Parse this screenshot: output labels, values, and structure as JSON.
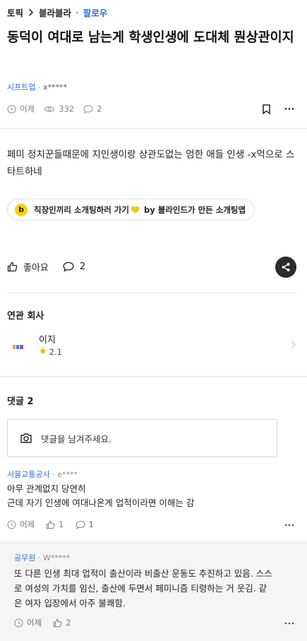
{
  "breadcrumb": {
    "topic": "토픽",
    "board": "블라블라",
    "follow": "팔로우"
  },
  "post": {
    "title": "동덕이 여대로 남는게 학생인생에 도대체 뭔상관이지",
    "company": "시프트업",
    "author": "x*****",
    "time": "어제",
    "views": "332",
    "comment_count": "2",
    "body": "페미 정치꾼들때문에 지인생이랑 상관도없는 엄한 애들 인생 -x억으로 스타트하네"
  },
  "ad": {
    "logo_letter": "b",
    "text_before": "직장인끼리 소개팅하러 가기",
    "text_after": "by 블라인드가 만든 소개팅앱"
  },
  "actions": {
    "like_label": "좋아요",
    "comment_count": "2"
  },
  "related": {
    "title": "연관 회사",
    "company_name": "이지",
    "rating": "2.1"
  },
  "comments_section": {
    "title": "댓글 2",
    "input_placeholder": "댓글을 남겨주세요."
  },
  "comments": [
    {
      "company": "서울교통공사",
      "author": "e****",
      "lines": [
        "아무 관계없지 당연히",
        "근데 자기 인생에 여대나온게 업적이라면 이해는 감"
      ],
      "time": "어제",
      "likes": "1",
      "replies": "1"
    }
  ],
  "reply": {
    "company": "공무원",
    "author": "W*****",
    "lines": [
      "또 다른 인생 최대 업적이 출산이라 비출산 운동도 추진하고 있음. 스스",
      "로 여성의 가치를 임신, 출산에 두면서 페미니즘 티령하는 거 웃김. 같",
      "은 여자 입장에서 아주 불쾌함."
    ],
    "time": "어제",
    "likes": "2"
  },
  "colors": {
    "accent_blue": "#2a6fd6",
    "star": "#f0b400",
    "share_bg": "#2b2b2b",
    "ad_logo": "#f7d117"
  },
  "icons": [
    "chevron-right-icon",
    "clock-icon",
    "eye-icon",
    "speech-bubble-icon",
    "bookmark-icon",
    "more-dots-icon",
    "thumb-up-icon",
    "share-icon",
    "camera-icon",
    "star-icon",
    "heart-icon"
  ]
}
